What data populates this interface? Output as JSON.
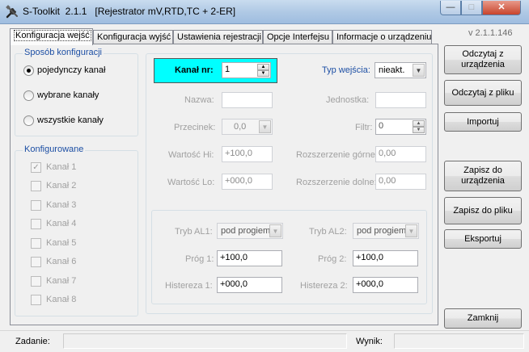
{
  "window": {
    "title": "S-Toolkit  2.1.1   [Rejestrator mV,RTD,TC + 2-ER]",
    "min_glyph": "—",
    "max_glyph": "□",
    "close_glyph": "✕"
  },
  "version": "v 2.1.1.146",
  "tabs": [
    {
      "label": "Konfiguracja wejść"
    },
    {
      "label": "Konfiguracja wyjść"
    },
    {
      "label": "Ustawienia rejestracji"
    },
    {
      "label": "Opcje Interfejsu"
    },
    {
      "label": "Informacje o urządzeniu"
    }
  ],
  "mode_group": {
    "title": "Sposób konfiguracji",
    "options": [
      "pojedynczy kanał",
      "wybrane kanały",
      "wszystkie kanały"
    ],
    "selected_index": 0
  },
  "configured_group": {
    "title": "Konfigurowane",
    "channels": [
      "Kanał 1",
      "Kanał 2",
      "Kanał 3",
      "Kanał 4",
      "Kanał 5",
      "Kanał 6",
      "Kanał 7",
      "Kanał 8"
    ],
    "checked_index": 0
  },
  "channel": {
    "label": "Kanał nr:",
    "value": "1"
  },
  "input_type": {
    "label": "Typ wejścia:",
    "value": "nieakt."
  },
  "fields": {
    "nazwa": {
      "label": "Nazwa:",
      "value": ""
    },
    "jednostka": {
      "label": "Jednostka:",
      "value": ""
    },
    "przecinek": {
      "label": "Przecinek:",
      "value": "0,0"
    },
    "filtr": {
      "label": "Filtr:",
      "value": "0"
    },
    "wartosc_hi": {
      "label": "Wartość Hi:",
      "value": "+100,0"
    },
    "rozszerzenie_gorne": {
      "label": "Rozszerzenie górne:",
      "value": "0,00"
    },
    "wartosc_lo": {
      "label": "Wartość Lo:",
      "value": "+000,0"
    },
    "rozszerzenie_dolne": {
      "label": "Rozszerzenie dolne:",
      "value": "0,00"
    }
  },
  "alarms": {
    "al1": {
      "mode_label": "Tryb AL1:",
      "mode": "pod progiem",
      "threshold_label": "Próg 1:",
      "threshold": "+100,0",
      "hyst_label": "Histereza 1:",
      "hyst": "+000,0"
    },
    "al2": {
      "mode_label": "Tryb AL2:",
      "mode": "pod progiem",
      "threshold_label": "Próg 2:",
      "threshold": "+100,0",
      "hyst_label": "Histereza 2:",
      "hyst": "+000,0"
    }
  },
  "buttons": {
    "read_device": "Odczytaj z urządzenia",
    "read_file": "Odczytaj z pliku",
    "import": "Importuj",
    "save_device": "Zapisz do urządzenia",
    "save_file": "Zapisz do pliku",
    "export": "Eksportuj",
    "close": "Zamknij"
  },
  "status": {
    "task_label": "Zadanie:",
    "task_value": "",
    "result_label": "Wynik:",
    "result_value": ""
  },
  "colors": {
    "channel_highlight": "#00ffff",
    "group_title": "#1d4fa4",
    "disabled_text": "#a0a0a0"
  }
}
